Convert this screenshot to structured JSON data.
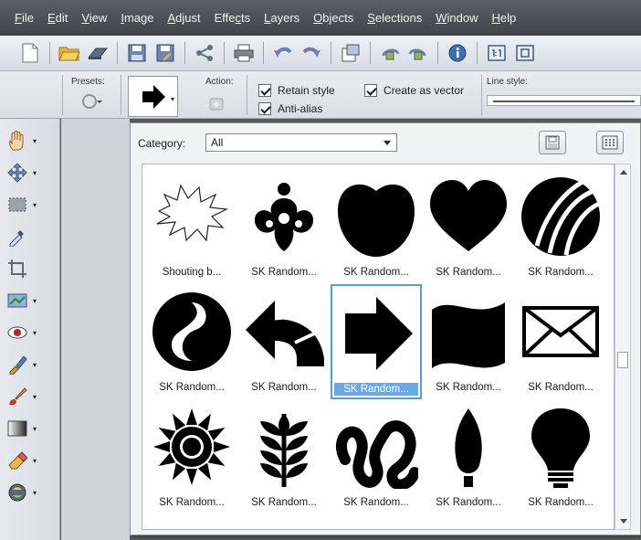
{
  "menu": [
    "File",
    "Edit",
    "View",
    "Image",
    "Adjust",
    "Effects",
    "Layers",
    "Objects",
    "Selections",
    "Window",
    "Help"
  ],
  "menu_underline": [
    "F",
    "E",
    "V",
    "I",
    "A",
    "c",
    "L",
    "O",
    "S",
    "W",
    "H"
  ],
  "toolbar_icons": [
    "new-icon",
    "open-icon",
    "scan-icon",
    "save-icon",
    "save-as-icon",
    "share-icon",
    "print-icon",
    "undo-icon",
    "redo-icon",
    "resize-icon",
    "rotate-left-icon",
    "rotate-right-icon",
    "info-icon",
    "actual-size-icon",
    "fit-icon"
  ],
  "options": {
    "presets_label": "Presets:",
    "action_label": "Action:",
    "retain_style": "Retain style",
    "anti_alias": "Anti-alias",
    "create_as_vector": "Create as vector",
    "line_style_label": "Line style:",
    "retain_style_checked": true,
    "anti_alias_checked": true,
    "create_as_vector_checked": true
  },
  "tools": [
    "pan-tool-icon",
    "move-tool-icon",
    "selection-tool-icon",
    "dropper-tool-icon",
    "crop-tool-icon",
    "straighten-tool-icon",
    "red-eye-tool-icon",
    "clone-tool-icon",
    "paint-brush-tool-icon",
    "gradient-tool-icon",
    "eraser-tool-icon",
    "color-changer-tool-icon"
  ],
  "panel": {
    "category_label": "Category:",
    "category_value": "All",
    "shapes": [
      {
        "label": "Shouting b...",
        "icon": "shouting-bubble-icon",
        "selected": false
      },
      {
        "label": "SK Random...",
        "icon": "ornament-icon",
        "selected": false
      },
      {
        "label": "SK Random...",
        "icon": "apple-icon",
        "selected": false
      },
      {
        "label": "SK Random...",
        "icon": "heart-icon",
        "selected": false
      },
      {
        "label": "SK Random...",
        "icon": "striped-ball-icon",
        "selected": false
      },
      {
        "label": "SK Random...",
        "icon": "yin-swirl-icon",
        "selected": false
      },
      {
        "label": "SK Random...",
        "icon": "curved-arrow-icon",
        "selected": false
      },
      {
        "label": "SK Random...",
        "icon": "arrow-right-icon",
        "selected": true
      },
      {
        "label": "SK Random...",
        "icon": "flag-icon",
        "selected": false
      },
      {
        "label": "SK Random...",
        "icon": "envelope-icon",
        "selected": false
      },
      {
        "label": "SK Random...",
        "icon": "sun-icon",
        "selected": false
      },
      {
        "label": "SK Random...",
        "icon": "leaf-icon",
        "selected": false
      },
      {
        "label": "SK Random...",
        "icon": "lotus-knot-icon",
        "selected": false
      },
      {
        "label": "SK Random...",
        "icon": "candle-flame-icon",
        "selected": false
      },
      {
        "label": "SK Random...",
        "icon": "light-bulb-icon",
        "selected": false
      }
    ]
  },
  "colors": {
    "selection": "#5a9bdc",
    "menubar": "#4a4e55"
  }
}
